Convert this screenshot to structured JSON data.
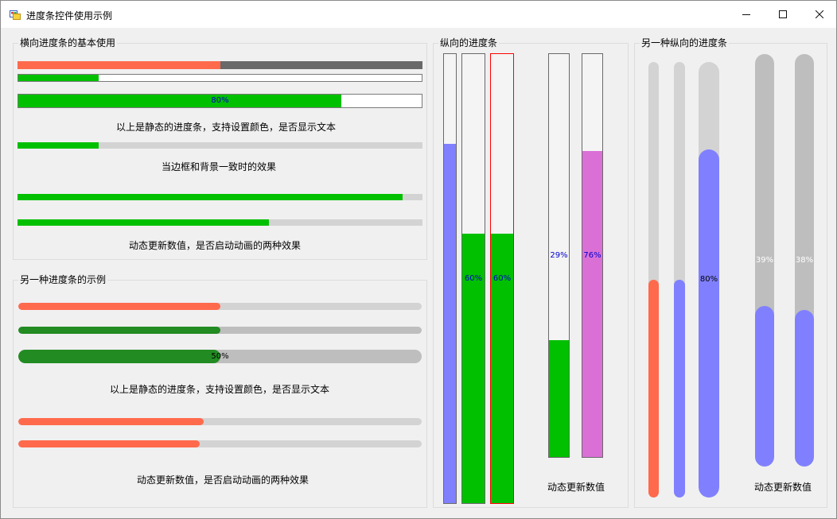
{
  "window": {
    "title": "进度条控件使用示例"
  },
  "titlebar_buttons": {
    "minimize": "minimize-icon",
    "maximize": "maximize-icon",
    "close": "close-icon"
  },
  "colors": {
    "red": "#ff6a4d",
    "green": "#00c000",
    "darkgreen": "#228b22",
    "blue": "#8080ff",
    "magenta": "#da70d6",
    "track_light": "#d3d3d3",
    "track_dark": "#bebebe",
    "track_gray": "#696969",
    "white_track": "#f4f4f4"
  },
  "horizontal_basic": {
    "title": "横向进度条的基本使用",
    "caption_static": "以上是静态的进度条，支持设置颜色，是否显示文本",
    "caption_border": "当边框和背景一致时的效果",
    "caption_dynamic": "动态更新数值，是否启动动画的两种效果",
    "bars": [
      {
        "value": 50,
        "color": "#ff6a4d",
        "track": "#696969",
        "border": false
      },
      {
        "value": 20,
        "color": "#00c000",
        "track": "#ffffff",
        "border": true
      },
      {
        "value": 80,
        "color": "#00c000",
        "track": "#ffffff",
        "border": true,
        "label": "80%"
      },
      {
        "value": 20,
        "color": "#00c000",
        "track": "#d3d3d3",
        "border": false
      },
      {
        "value": 95,
        "color": "#00c000",
        "track": "#d3d3d3",
        "border": false
      },
      {
        "value": 62,
        "color": "#00c000",
        "track": "#d3d3d3",
        "border": false
      }
    ]
  },
  "horizontal_rounded": {
    "title": "另一种进度条的示例",
    "caption_static": "以上是静态的进度条，支持设置颜色，是否显示文本",
    "caption_dynamic": "动态更新数值，是否启动动画的两种效果",
    "bars": [
      {
        "value": 50,
        "color": "#ff6a4d",
        "track": "#d3d3d3"
      },
      {
        "value": 50,
        "color": "#228b22",
        "track": "#bebebe"
      },
      {
        "value": 50,
        "color": "#228b22",
        "track": "#bebebe",
        "label": "50%"
      },
      {
        "value": 46,
        "color": "#ff6a4d",
        "track": "#d3d3d3"
      },
      {
        "value": 45,
        "color": "#ff6a4d",
        "track": "#d3d3d3"
      }
    ]
  },
  "vertical_basic": {
    "title": "纵向的进度条",
    "caption_dynamic": "动态更新数值",
    "bars": [
      {
        "value": 80,
        "color": "#8080ff",
        "track": "#f4f4f4",
        "border": "#696969"
      },
      {
        "value": 60,
        "color": "#00c000",
        "track": "#f4f4f4",
        "border": "#696969",
        "label": "60%"
      },
      {
        "value": 60,
        "color": "#00c000",
        "track": "#f4f4f4",
        "border": "#ff0000",
        "label": "60%"
      },
      {
        "value": 29,
        "color": "#00c000",
        "track": "#f4f4f4",
        "border": "#696969",
        "label": "29%"
      },
      {
        "value": 76,
        "color": "#da70d6",
        "track": "#f4f4f4",
        "border": "#696969",
        "label": "76%"
      }
    ]
  },
  "vertical_rounded": {
    "title": "另一种纵向的进度条",
    "caption_dynamic": "动态更新数值",
    "bars": [
      {
        "value": 50,
        "color": "#ff6a4d",
        "track": "#d3d3d3"
      },
      {
        "value": 50,
        "color": "#8080ff",
        "track": "#d3d3d3"
      },
      {
        "value": 80,
        "color": "#8080ff",
        "track": "#d3d3d3",
        "label": "80%"
      },
      {
        "value": 39,
        "color": "#8080ff",
        "track": "#bebebe",
        "label": "39%"
      },
      {
        "value": 38,
        "color": "#8080ff",
        "track": "#bebebe",
        "label": "38%"
      }
    ]
  }
}
